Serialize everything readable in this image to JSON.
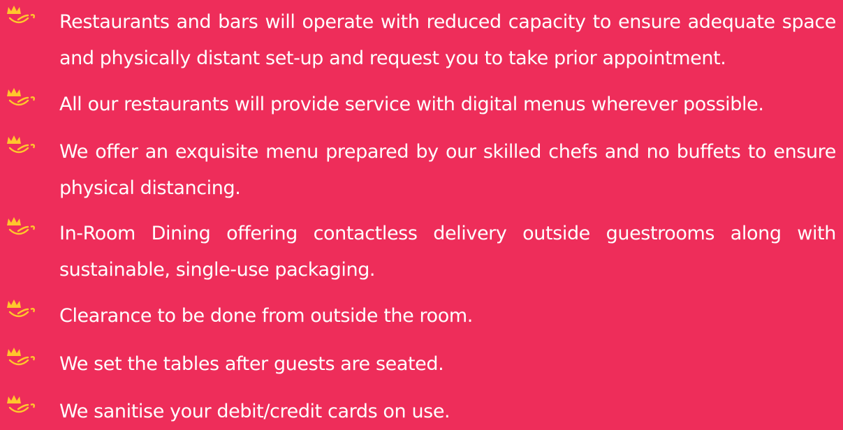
{
  "colors": {
    "background": "#ee2d5a",
    "text": "#ffffff",
    "icon": "#ffc72c"
  },
  "items": [
    {
      "icon": "lotus-bullet-icon",
      "text": "Restaurants and bars will operate with reduced capacity to ensure adequate space and physically distant set-up and request you to take prior appointment."
    },
    {
      "icon": "lotus-bullet-icon",
      "text": "All our restaurants will provide service with digital menus wherever possible."
    },
    {
      "icon": "lotus-bullet-icon",
      "text": "We offer an exquisite menu prepared by our skilled chefs and no buffets to ensure physical distancing."
    },
    {
      "icon": "lotus-bullet-icon",
      "text": "In-Room Dining offering contactless delivery outside guestrooms along with sustainable, single-use packaging."
    },
    {
      "icon": "lotus-bullet-icon",
      "text": "Clearance to be done from outside the room."
    },
    {
      "icon": "lotus-bullet-icon",
      "text": "We set the tables after guests are seated."
    },
    {
      "icon": "lotus-bullet-icon",
      "text": "We sanitise your debit/credit cards on use."
    }
  ]
}
